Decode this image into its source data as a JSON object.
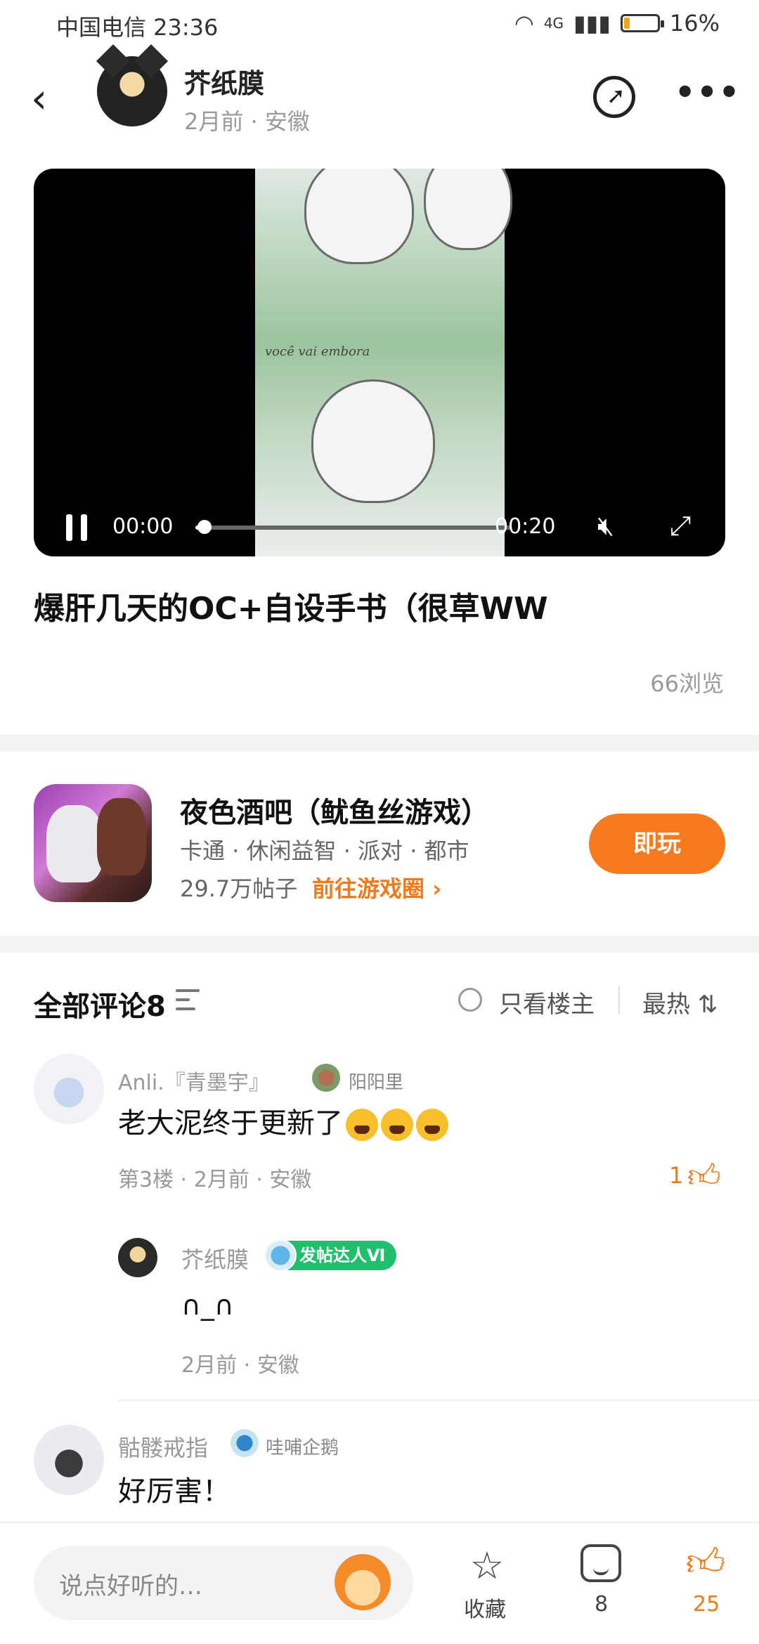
{
  "status_bar": {
    "carrier_time": "中国电信 23:36",
    "network": "4G",
    "battery": "16%",
    "battery_level": 0.16
  },
  "header": {
    "author": "芥纸膜",
    "meta": "2月前 · 安徽"
  },
  "video": {
    "overlay_text": "você vai embora",
    "current_time": "00:00",
    "total_time": "00:20",
    "progress": 0.02
  },
  "post": {
    "title": "爆肝几天的OC+自设手书（很草WW",
    "views": "66浏览"
  },
  "game": {
    "name": "夜色酒吧（鱿鱼丝游戏）",
    "tags": "卡通 · 休闲益智 · 派对 · 都市",
    "stats": "29.7万帖子",
    "link": "前往游戏圈 ›",
    "play_label": "即玩"
  },
  "comments_header": {
    "title": "全部评论8",
    "owner_only": "只看楼主",
    "sort": "最热 ⇅"
  },
  "comments": [
    {
      "name": "Anli.『青墨宇』",
      "badge": "阳阳里",
      "text": "老大泥终于更新了",
      "meta": "第3楼 · 2月前 · 安徽",
      "likes": "1"
    },
    {
      "name": "骷髅戒指",
      "badge": "哇哺企鹅",
      "text": "好厉害！"
    }
  ],
  "reply": {
    "name": "芥纸膜",
    "badge": "发帖达人Ⅵ",
    "text": "∩_∩",
    "meta": "2月前 · 安徽"
  },
  "bottom_bar": {
    "placeholder": "说点好听的…",
    "favorite": "收藏",
    "comment_count": "8",
    "like_count": "25"
  },
  "icons": {
    "back": "back-arrow-icon",
    "share": "share-icon",
    "more": "more-icon",
    "pause": "pause-icon",
    "mute": "mute-icon",
    "fullscreen": "fullscreen-icon",
    "sort": "sort-filter-icon",
    "like": "thumbs-up-icon",
    "star": "star-icon",
    "comment": "comment-icon"
  },
  "colors": {
    "accent": "#f77a1e",
    "badge_green": "#1fbf6e"
  }
}
